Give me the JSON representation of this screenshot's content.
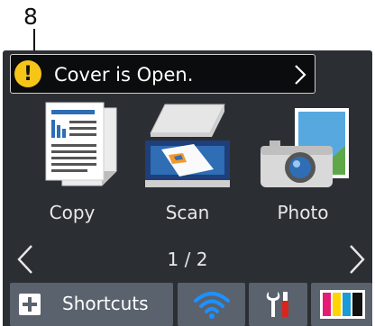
{
  "callout": {
    "number": "8"
  },
  "status": {
    "message": "Cover is Open.",
    "icon": "warning-icon",
    "icon_symbol": "!"
  },
  "apps": [
    {
      "label": "Copy",
      "icon": "copy-icon"
    },
    {
      "label": "Scan",
      "icon": "scan-icon"
    },
    {
      "label": "Photo",
      "icon": "photo-icon"
    }
  ],
  "pager": {
    "page_text": "1 / 2"
  },
  "bottom": {
    "shortcuts_label": "Shortcuts"
  },
  "colors": {
    "screen_bg": "#2b2f34",
    "status_bg": "#0b0c0d",
    "warning": "#f5c518",
    "button_bg": "#59626d",
    "wifi": "#1e90ff"
  }
}
